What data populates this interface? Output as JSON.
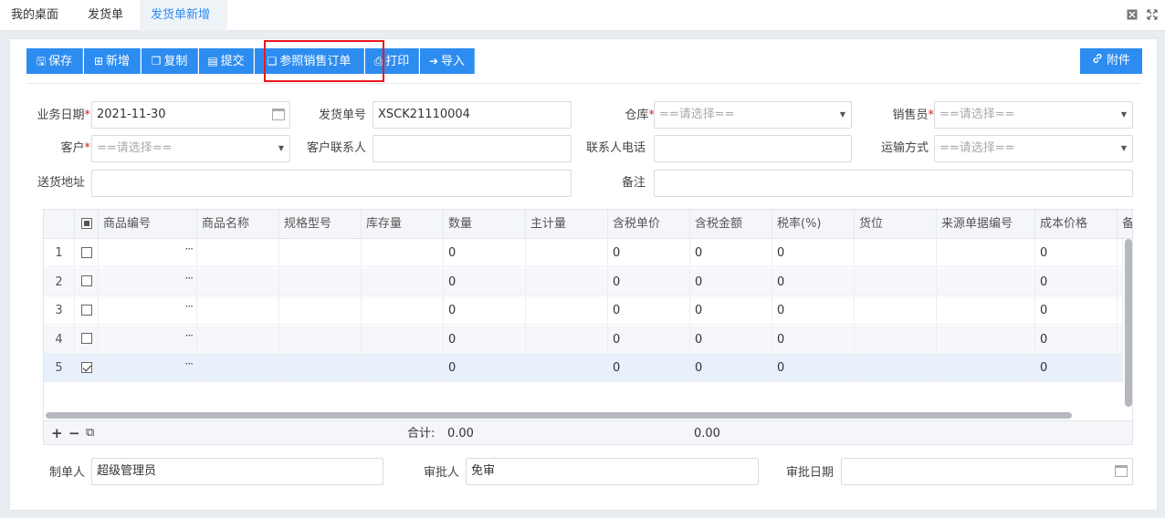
{
  "tabs": [
    {
      "label": "我的桌面",
      "active": false
    },
    {
      "label": "发货单",
      "active": false
    },
    {
      "label": "发货单新增",
      "active": true
    }
  ],
  "toolbar": {
    "buttons": [
      {
        "label": "保存",
        "icon": "save-icon",
        "glyph": "🖫"
      },
      {
        "label": "新增",
        "icon": "plus-square-icon",
        "glyph": "⊞"
      },
      {
        "label": "复制",
        "icon": "copy-icon",
        "glyph": "❐"
      },
      {
        "label": "提交",
        "icon": "document-icon",
        "glyph": "▤"
      },
      {
        "label": "参照销售订单",
        "icon": "paste-icon",
        "glyph": "❏"
      },
      {
        "label": "打印",
        "icon": "print-icon",
        "glyph": "⎙"
      },
      {
        "label": "导入",
        "icon": "import-icon",
        "glyph": "➔"
      }
    ],
    "attach": {
      "label": "附件",
      "icon": "link-icon",
      "glyph": "🔗"
    }
  },
  "form": {
    "biz_date": {
      "label": "业务日期",
      "value": "2021-11-30",
      "required": true
    },
    "ship_no": {
      "label": "发货单号",
      "value": "XSCK21110004"
    },
    "warehouse": {
      "label": "仓库",
      "placeholder": "==请选择==",
      "required": true
    },
    "salesman": {
      "label": "销售员",
      "placeholder": "==请选择==",
      "required": true
    },
    "customer": {
      "label": "客户",
      "placeholder": "==请选择==",
      "required": true
    },
    "contact": {
      "label": "客户联系人",
      "value": ""
    },
    "contact_phone": {
      "label": "联系人电话",
      "value": ""
    },
    "transport": {
      "label": "运输方式",
      "placeholder": "==请选择=="
    },
    "address": {
      "label": "送货地址",
      "value": ""
    },
    "remark": {
      "label": "备注",
      "value": ""
    },
    "required_mark": "*"
  },
  "grid": {
    "columns": [
      "商品编号",
      "商品名称",
      "规格型号",
      "库存量",
      "数量",
      "主计量",
      "含税单价",
      "含税金额",
      "税率(%)",
      "货位",
      "来源单据编号",
      "成本价格",
      "备"
    ],
    "rows": [
      {
        "no": "1",
        "checked": false,
        "qty": "0",
        "price": "0",
        "amount": "0",
        "tax": "0",
        "cost": "0"
      },
      {
        "no": "2",
        "checked": false,
        "qty": "0",
        "price": "0",
        "amount": "0",
        "tax": "0",
        "cost": "0"
      },
      {
        "no": "3",
        "checked": false,
        "qty": "0",
        "price": "0",
        "amount": "0",
        "tax": "0",
        "cost": "0"
      },
      {
        "no": "4",
        "checked": false,
        "qty": "0",
        "price": "0",
        "amount": "0",
        "tax": "0",
        "cost": "0"
      },
      {
        "no": "5",
        "checked": true,
        "qty": "0",
        "price": "0",
        "amount": "0",
        "tax": "0",
        "cost": "0"
      }
    ],
    "more_glyph": "···",
    "footer": {
      "add_glyph": "+",
      "remove_glyph": "−",
      "copy_glyph": "⧉",
      "total_label": "合计:",
      "qty_total": "0.00",
      "amount_total": "0.00"
    }
  },
  "bottom": {
    "maker": {
      "label": "制单人",
      "value": "超级管理员"
    },
    "approver": {
      "label": "审批人",
      "value": "免审"
    },
    "approve_date": {
      "label": "审批日期",
      "value": ""
    }
  },
  "colors": {
    "accent": "#2d8cf0",
    "highlight": "#e8191d"
  }
}
